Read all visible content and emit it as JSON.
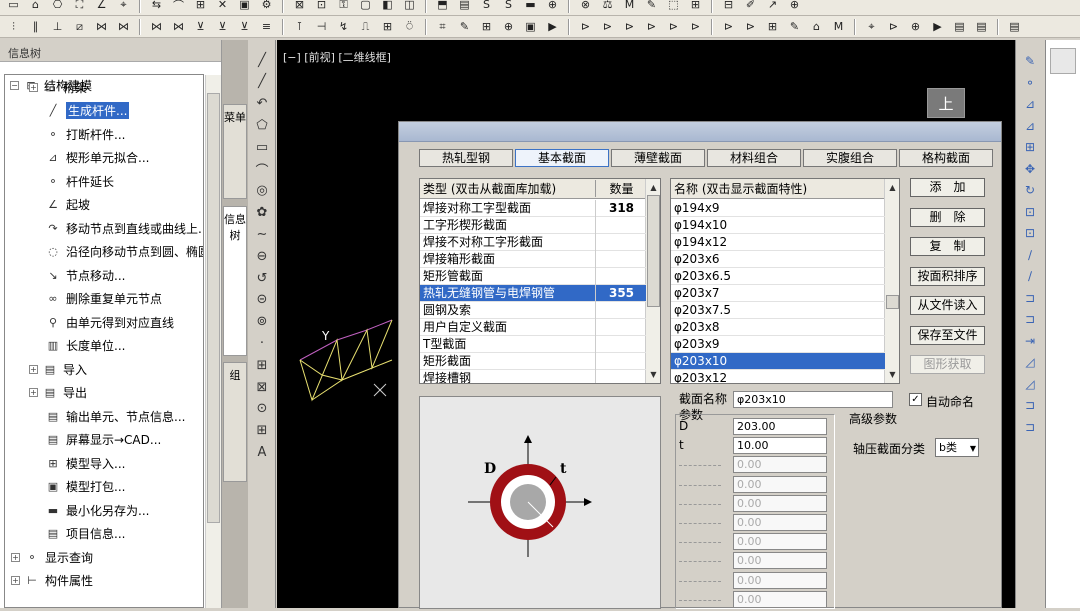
{
  "toolbar": {
    "row1": [
      "▭",
      "⌂",
      "⎔",
      "⛶",
      "∠",
      "⌖",
      "⇆",
      "⌒",
      "⊞",
      "✕",
      "▣",
      "⚙",
      "⊠",
      "⊡",
      "⚿",
      "▢",
      "◧",
      "◫",
      "⬒",
      "▤",
      "S",
      "S",
      "▬",
      "⊕",
      "⊗",
      "⚖",
      "M",
      "✎",
      "⬚",
      "⊞",
      "⊟",
      "✐",
      "↗",
      "⊕"
    ],
    "row2": [
      "⫶",
      "∥",
      "⊥",
      "⧄",
      "⋈",
      "⋈",
      "⋈",
      "⋈",
      "⊻",
      "⊻",
      "⊻",
      "≡",
      "⊺",
      "⊣",
      "↯",
      "⎍",
      "⊞",
      "⍥",
      "⌗",
      "✎",
      "⊞",
      "⊕",
      "▣",
      "▶",
      "⊳",
      "⊳",
      "⊳",
      "⊳",
      "⊳",
      "⊳",
      "⊳",
      "⊳",
      "⊞",
      "✎",
      "⌂",
      "M",
      "⌖",
      "⊳",
      "⊕",
      "▶",
      "▤",
      "▤",
      "▤"
    ]
  },
  "sidebar": {
    "title": "信息树",
    "root_label": "结构建模",
    "items": [
      {
        "label": "桁架",
        "icon": "⊡",
        "toggle": "+",
        "indent": 1
      },
      {
        "label": "生成杆件...",
        "icon": "╱",
        "selected": true,
        "indent": 2
      },
      {
        "label": "打断杆件...",
        "icon": "⚬",
        "indent": 2
      },
      {
        "label": "楔形单元拟合...",
        "icon": "⊿",
        "indent": 2
      },
      {
        "label": "杆件延长",
        "icon": "⚬",
        "indent": 2
      },
      {
        "label": "起坡",
        "icon": "∠",
        "indent": 2
      },
      {
        "label": "移动节点到直线或曲线上...",
        "icon": "↷",
        "indent": 2
      },
      {
        "label": "沿径向移动节点到圆、椭圆",
        "icon": "◌",
        "indent": 2
      },
      {
        "label": "节点移动...",
        "icon": "↘",
        "indent": 2
      },
      {
        "label": "删除重复单元节点",
        "icon": "∞",
        "indent": 2
      },
      {
        "label": "由单元得到对应直线",
        "icon": "⚲",
        "indent": 2
      },
      {
        "label": "长度单位...",
        "icon": "▥",
        "indent": 2
      },
      {
        "label": "导入",
        "icon": "▤",
        "toggle": "+",
        "indent": 1
      },
      {
        "label": "导出",
        "icon": "▤",
        "toggle": "+",
        "indent": 1
      },
      {
        "label": "输出单元、节点信息...",
        "icon": "▤",
        "indent": 2
      },
      {
        "label": "屏幕显示→CAD...",
        "icon": "▤",
        "indent": 2
      },
      {
        "label": "模型导入...",
        "icon": "⊞",
        "indent": 2
      },
      {
        "label": "模型打包...",
        "icon": "▣",
        "indent": 2
      },
      {
        "label": "最小化另存为...",
        "icon": "▬",
        "indent": 2
      },
      {
        "label": "项目信息...",
        "icon": "▤",
        "indent": 2
      },
      {
        "label": "显示查询",
        "icon": "⚬",
        "toggle": "+",
        "indent": 0
      },
      {
        "label": "构件属性",
        "icon": "⊢",
        "toggle": "+",
        "indent": 0
      }
    ],
    "vtabs": [
      "菜单",
      "信息树",
      "组"
    ]
  },
  "lefttoolbar": [
    "╱",
    "╱",
    "↶",
    "⬠",
    "▭",
    "⌒",
    "◎",
    "✿",
    "∼",
    "⊖",
    "↺",
    "⊝",
    "⊚",
    "·",
    "⊞",
    "⊠",
    "⊙",
    "⊞",
    "A"
  ],
  "righttoolbar": [
    "✎",
    "⚬",
    "⊿",
    "⊿",
    "⊞",
    "✥",
    "↻",
    "⊡",
    "⊡",
    "∕",
    "∕",
    "⊐",
    "⊐",
    "⇥",
    "◿",
    "◿",
    "⊐",
    "⊐"
  ],
  "viewport": {
    "label": "[−] [前视] [二维线框]",
    "viewcube": "上"
  },
  "dialog": {
    "tabs": [
      "热轧型钢",
      "基本截面",
      "薄壁截面",
      "材料组合",
      "实腹组合",
      "格构截面"
    ],
    "active_tab": 1,
    "type_list": {
      "header_type": "类型 (双击从截面库加载)",
      "header_count": "数量",
      "rows": [
        {
          "name": "焊接对称工字型截面",
          "count": "318"
        },
        {
          "name": "工字形楔形截面",
          "count": ""
        },
        {
          "name": "焊接不对称工字形截面",
          "count": ""
        },
        {
          "name": "焊接箱形截面",
          "count": ""
        },
        {
          "name": "矩形管截面",
          "count": ""
        },
        {
          "name": "热轧无缝钢管与电焊钢管",
          "count": "355",
          "selected": true
        },
        {
          "name": "圆钢及索",
          "count": ""
        },
        {
          "name": "用户自定义截面",
          "count": ""
        },
        {
          "name": "T型截面",
          "count": ""
        },
        {
          "name": "矩形截面",
          "count": ""
        },
        {
          "name": "焊接槽钢",
          "count": ""
        }
      ]
    },
    "name_list": {
      "header": "名称 (双击显示截面特性)",
      "rows": [
        "φ194x9",
        "φ194x10",
        "φ194x12",
        "φ203x6",
        "φ203x6.5",
        "φ203x7",
        "φ203x7.5",
        "φ203x8",
        "φ203x9",
        "φ203x10",
        "φ203x12"
      ],
      "selected_index": 9
    },
    "buttons": [
      "添　加",
      "删　除",
      "复　制",
      "按面积排序",
      "从文件读入",
      "保存至文件",
      "图形获取"
    ],
    "section_name_label": "截面名称",
    "section_name_value": "φ203x10",
    "auto_name_label": "自动命名",
    "auto_name_checked": true,
    "params_label": "参数",
    "params": [
      {
        "name": "D",
        "value": "203.00"
      },
      {
        "name": "t",
        "value": "10.00"
      },
      {
        "name": "",
        "value": "0.00"
      },
      {
        "name": "",
        "value": "0.00"
      },
      {
        "name": "",
        "value": "0.00"
      },
      {
        "name": "",
        "value": "0.00"
      },
      {
        "name": "",
        "value": "0.00"
      },
      {
        "name": "",
        "value": "0.00"
      },
      {
        "name": "",
        "value": "0.00"
      },
      {
        "name": "",
        "value": "0.00"
      }
    ],
    "advanced_label": "高级参数",
    "axial_class_label": "轴压截面分类",
    "axial_class_value": "b类",
    "preview_labels": {
      "D": "D",
      "t": "t"
    },
    "colors": {
      "ring": "#a01015",
      "core": "#a8a8a8",
      "accent": "#3169c6"
    }
  }
}
